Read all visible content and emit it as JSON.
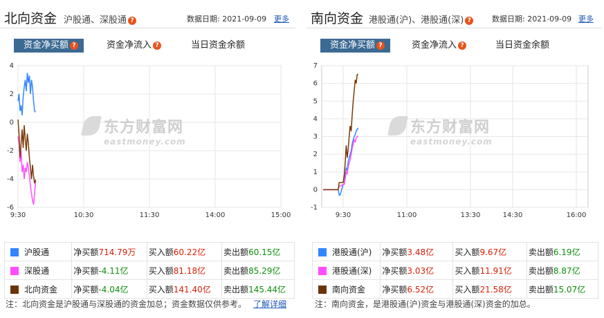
{
  "north": {
    "title": "北向资金",
    "subtitle": "沪股通、深股通",
    "date": "数据日期: 2021-09-09",
    "more": "更多",
    "tabs": [
      "资金净买额",
      "资金净流入",
      "当日资金余额"
    ],
    "watermark_cn": "东方财富网",
    "watermark_en": "eastmoney.com",
    "chart_data": {
      "type": "line",
      "x_ticks": [
        "9:30",
        "10:30",
        "11:30",
        "14:00",
        "15:00"
      ],
      "y_ticks": [
        "4",
        "2",
        "0",
        "-2",
        "-4",
        "-6"
      ],
      "ylim": [
        -6,
        4
      ],
      "grid": true,
      "series": [
        {
          "name": "沪股通",
          "color": "#3385ff",
          "x_minutes": [
            0,
            1,
            2,
            3,
            4,
            5,
            6,
            7,
            8,
            9,
            10,
            11,
            12,
            13,
            14,
            15,
            16,
            17
          ],
          "values": [
            1.5,
            2.0,
            0.8,
            1.2,
            0.5,
            1.8,
            2.5,
            3.0,
            2.2,
            3.5,
            2.8,
            3.3,
            2.0,
            3.0,
            2.5,
            1.5,
            0.8,
            0.71
          ]
        },
        {
          "name": "深股通",
          "color": "#ff4dff",
          "x_minutes": [
            0,
            1,
            2,
            3,
            4,
            5,
            6,
            7,
            8,
            9,
            10,
            11,
            12,
            13,
            14,
            15,
            16,
            17
          ],
          "values": [
            -1.0,
            -1.5,
            -2.8,
            -2.0,
            -3.5,
            -3.0,
            -4.0,
            -3.2,
            -3.5,
            -2.8,
            -3.2,
            -3.8,
            -4.5,
            -5.0,
            -5.5,
            -5.8,
            -5.0,
            -4.11
          ]
        },
        {
          "name": "北向资金",
          "color": "#7a3a06",
          "x_minutes": [
            0,
            1,
            2,
            3,
            4,
            5,
            6,
            7,
            8,
            9,
            10,
            11,
            12,
            13,
            14,
            15,
            16,
            17
          ],
          "values": [
            0.2,
            -0.8,
            -2.5,
            -1.5,
            -0.5,
            -1.8,
            -0.2,
            -1.2,
            -2.0,
            -0.8,
            -1.5,
            -2.5,
            -3.2,
            -4.0,
            -3.0,
            -3.8,
            -4.3,
            -4.04
          ]
        }
      ]
    },
    "rows": [
      {
        "name": "沪股通",
        "color": "#3385ff",
        "net_label": "净买额",
        "net": "714.79万",
        "net_color": "red",
        "buy_label": "买入额",
        "buy": "60.22亿",
        "sell_label": "卖出额",
        "sell": "60.15亿"
      },
      {
        "name": "深股通",
        "color": "#ff4dff",
        "net_label": "净买额",
        "net": "-4.11亿",
        "net_color": "green",
        "buy_label": "买入额",
        "buy": "81.18亿",
        "sell_label": "卖出额",
        "sell": "85.29亿"
      },
      {
        "name": "北向资金",
        "color": "#6b3408",
        "net_label": "净买额",
        "net": "-4.04亿",
        "net_color": "green",
        "buy_label": "买入额",
        "buy": "141.40亿",
        "sell_label": "卖出额",
        "sell": "145.44亿"
      }
    ],
    "note": "注：北向资金是沪股通与深股通的资金加总；资金数据仅供参考。",
    "note_link": "了解详细"
  },
  "south": {
    "title": "南向资金",
    "subtitle": "港股通(沪)、港股通(深)",
    "date": "数据日期: 2021-09-09",
    "more": "更多",
    "tabs": [
      "资金净买额",
      "资金净流入",
      "当日资金余额"
    ],
    "watermark_cn": "东方财富网",
    "watermark_en": "eastmoney.com",
    "chart_data": {
      "type": "line",
      "x_ticks": [
        "9:30",
        "11:00",
        "13:30",
        "14:30",
        "16:00"
      ],
      "y_ticks": [
        "7",
        "6",
        "5",
        "4",
        "3",
        "2",
        "1",
        "0",
        "-1"
      ],
      "ylim": [
        -1,
        7
      ],
      "grid": true,
      "series": [
        {
          "name": "港股通(沪)",
          "color": "#3385ff",
          "x_minutes": [
            -20,
            -5,
            -4,
            -3,
            0,
            1,
            2,
            3,
            4,
            5,
            6,
            7,
            8,
            9,
            10,
            11,
            12,
            13,
            14,
            15
          ],
          "values": [
            0,
            0,
            -0.3,
            -0.3,
            0.3,
            0.3,
            0.8,
            1.2,
            1.1,
            1.6,
            1.8,
            2.0,
            2.2,
            2.6,
            2.8,
            3.0,
            3.1,
            3.3,
            3.4,
            3.48
          ]
        },
        {
          "name": "港股通(深)",
          "color": "#ff4dff",
          "x_minutes": [
            -20,
            -5,
            -4,
            -3,
            0,
            1,
            2,
            3,
            4,
            5,
            6,
            7,
            8,
            9,
            10,
            11,
            12,
            13,
            14,
            15
          ],
          "values": [
            0,
            0,
            0.2,
            0.2,
            0.3,
            0.3,
            0.6,
            1.0,
            0.9,
            1.3,
            1.5,
            1.7,
            2.0,
            2.3,
            2.6,
            2.8,
            2.7,
            2.9,
            3.0,
            3.03
          ]
        },
        {
          "name": "南向资金",
          "color": "#7a3a06",
          "x_minutes": [
            -20,
            -5,
            -4,
            -3,
            0,
            1,
            2,
            3,
            4,
            5,
            6,
            7,
            8,
            9,
            10,
            11,
            12,
            13,
            14,
            15
          ],
          "values": [
            0,
            0,
            0.4,
            0.4,
            0.4,
            0.8,
            1.5,
            2.5,
            1.8,
            2.3,
            3.0,
            3.6,
            3.3,
            4.2,
            5.0,
            5.6,
            6.2,
            6.0,
            6.5,
            6.52
          ]
        }
      ]
    },
    "rows": [
      {
        "name": "港股通(沪)",
        "color": "#3385ff",
        "net_label": "净买额",
        "net": "3.48亿",
        "net_color": "red",
        "buy_label": "买入额",
        "buy": "9.67亿",
        "sell_label": "卖出额",
        "sell": "6.19亿"
      },
      {
        "name": "港股通(深)",
        "color": "#ff4dff",
        "net_label": "净买额",
        "net": "3.03亿",
        "net_color": "red",
        "buy_label": "买入额",
        "buy": "11.91亿",
        "sell_label": "卖出额",
        "sell": "8.87亿"
      },
      {
        "name": "南向资金",
        "color": "#6b3408",
        "net_label": "净买额",
        "net": "6.52亿",
        "net_color": "red",
        "buy_label": "买入额",
        "buy": "21.58亿",
        "sell_label": "卖出额",
        "sell": "15.07亿"
      }
    ],
    "note": "注：南向资金，是港股通(沪)资金与港股通(深)资金的加总。"
  }
}
